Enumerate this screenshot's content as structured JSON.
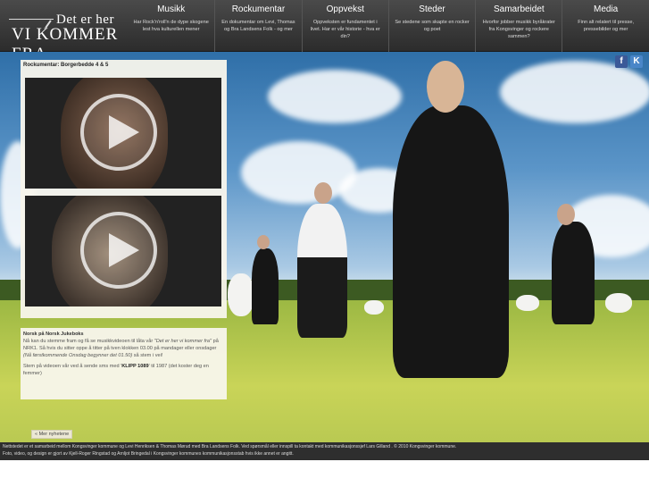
{
  "logo": {
    "line1": "Det er her",
    "line2": "VI KOMMER FRA"
  },
  "nav": [
    {
      "title": "Musikk",
      "desc": "Har Rock'n'roll'n de dype skogene lest hva kulturellen mener"
    },
    {
      "title": "Rockumentar",
      "desc": "En dokumentar om Levi, Thomas og Bra Landsens Folk - og mer"
    },
    {
      "title": "Oppvekst",
      "desc": "Oppveksten er fundamentet i livet. Har er vår historie - hva er din?"
    },
    {
      "title": "Steder",
      "desc": "Se stedene som skapte en rocker og poet"
    },
    {
      "title": "Samarbeidet",
      "desc": "Hvorfor jobber musikk byråkrater fra Kongsvinger og rockere sammen?"
    },
    {
      "title": "Media",
      "desc": "Finn alt relatert til presse, pressebilder og mer"
    }
  ],
  "social": [
    {
      "icon": "facebook-icon",
      "glyph": "f",
      "color": "#3b5998"
    },
    {
      "icon": "k-icon",
      "glyph": "K",
      "color": "#4a86c8"
    }
  ],
  "panel": {
    "title": "Rockumentar: Borgerbedde 4 & 5"
  },
  "textbox": {
    "title": "Norsk på Norsk Jukeboks",
    "p1_a": "Nå kan du stemme fram og få se musikkvideoen til låta vår ",
    "p1_song": "\"Det er her vi kommer fra\"",
    "p1_b": " på NRK1. Så hvis du sitter oppe å titter på tven klokken 03.00 på mandager eller onsdager ",
    "p1_note": "(Nå førstkommende Onsdag begynner det 01.50)",
    "p1_c": " så stem i vei!",
    "p2_a": "Stem på videoen vår ved å sende sms med '",
    "p2_code": "KLIPP 1089",
    "p2_b": "' til 1987 (det koster deg en femmer)"
  },
  "more_button": "« Mer nyhetene",
  "footer": {
    "line1": "Nettstedet er et samarbeid mellom Kongsvinger kommune og Levi Henriksen & Thomas Mørud med Bra Landsens Folk. Ved spørsmål eller innspill ta kontakt med kommunikasjonssjef Lars Gilland . © 2010 Kongsvinger kommune.",
    "line2": "Foto, video, og design er gjort av Kjell-Roger Ringstad og Arnljot Bringedal i Kongsvinger kommunes kommunikasjonsstab hvis ikke annet er angitt."
  }
}
